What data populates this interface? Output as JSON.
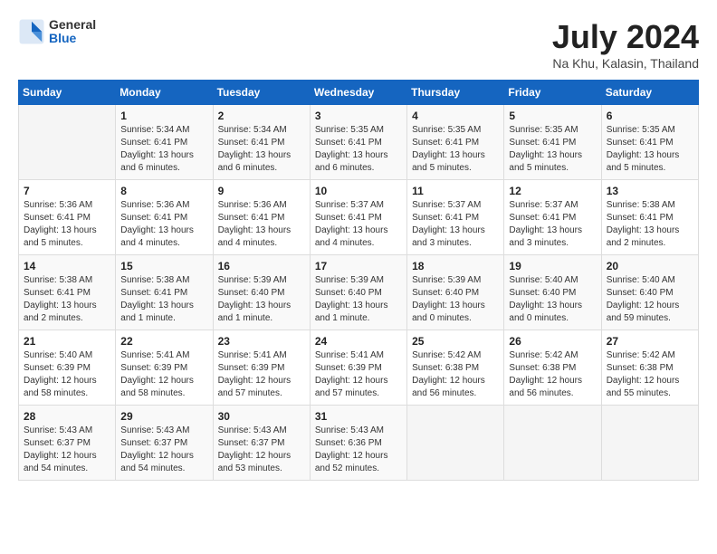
{
  "header": {
    "logo_general": "General",
    "logo_blue": "Blue",
    "month": "July 2024",
    "location": "Na Khu, Kalasin, Thailand"
  },
  "weekdays": [
    "Sunday",
    "Monday",
    "Tuesday",
    "Wednesday",
    "Thursday",
    "Friday",
    "Saturday"
  ],
  "weeks": [
    [
      null,
      {
        "day": 1,
        "sunrise": "5:34 AM",
        "sunset": "6:41 PM",
        "daylight": "13 hours and 6 minutes."
      },
      {
        "day": 2,
        "sunrise": "5:34 AM",
        "sunset": "6:41 PM",
        "daylight": "13 hours and 6 minutes."
      },
      {
        "day": 3,
        "sunrise": "5:35 AM",
        "sunset": "6:41 PM",
        "daylight": "13 hours and 6 minutes."
      },
      {
        "day": 4,
        "sunrise": "5:35 AM",
        "sunset": "6:41 PM",
        "daylight": "13 hours and 5 minutes."
      },
      {
        "day": 5,
        "sunrise": "5:35 AM",
        "sunset": "6:41 PM",
        "daylight": "13 hours and 5 minutes."
      },
      {
        "day": 6,
        "sunrise": "5:35 AM",
        "sunset": "6:41 PM",
        "daylight": "13 hours and 5 minutes."
      }
    ],
    [
      {
        "day": 7,
        "sunrise": "5:36 AM",
        "sunset": "6:41 PM",
        "daylight": "13 hours and 5 minutes."
      },
      {
        "day": 8,
        "sunrise": "5:36 AM",
        "sunset": "6:41 PM",
        "daylight": "13 hours and 4 minutes."
      },
      {
        "day": 9,
        "sunrise": "5:36 AM",
        "sunset": "6:41 PM",
        "daylight": "13 hours and 4 minutes."
      },
      {
        "day": 10,
        "sunrise": "5:37 AM",
        "sunset": "6:41 PM",
        "daylight": "13 hours and 4 minutes."
      },
      {
        "day": 11,
        "sunrise": "5:37 AM",
        "sunset": "6:41 PM",
        "daylight": "13 hours and 3 minutes."
      },
      {
        "day": 12,
        "sunrise": "5:37 AM",
        "sunset": "6:41 PM",
        "daylight": "13 hours and 3 minutes."
      },
      {
        "day": 13,
        "sunrise": "5:38 AM",
        "sunset": "6:41 PM",
        "daylight": "13 hours and 2 minutes."
      }
    ],
    [
      {
        "day": 14,
        "sunrise": "5:38 AM",
        "sunset": "6:41 PM",
        "daylight": "13 hours and 2 minutes."
      },
      {
        "day": 15,
        "sunrise": "5:38 AM",
        "sunset": "6:41 PM",
        "daylight": "13 hours and 1 minute."
      },
      {
        "day": 16,
        "sunrise": "5:39 AM",
        "sunset": "6:40 PM",
        "daylight": "13 hours and 1 minute."
      },
      {
        "day": 17,
        "sunrise": "5:39 AM",
        "sunset": "6:40 PM",
        "daylight": "13 hours and 1 minute."
      },
      {
        "day": 18,
        "sunrise": "5:39 AM",
        "sunset": "6:40 PM",
        "daylight": "13 hours and 0 minutes."
      },
      {
        "day": 19,
        "sunrise": "5:40 AM",
        "sunset": "6:40 PM",
        "daylight": "13 hours and 0 minutes."
      },
      {
        "day": 20,
        "sunrise": "5:40 AM",
        "sunset": "6:40 PM",
        "daylight": "12 hours and 59 minutes."
      }
    ],
    [
      {
        "day": 21,
        "sunrise": "5:40 AM",
        "sunset": "6:39 PM",
        "daylight": "12 hours and 58 minutes."
      },
      {
        "day": 22,
        "sunrise": "5:41 AM",
        "sunset": "6:39 PM",
        "daylight": "12 hours and 58 minutes."
      },
      {
        "day": 23,
        "sunrise": "5:41 AM",
        "sunset": "6:39 PM",
        "daylight": "12 hours and 57 minutes."
      },
      {
        "day": 24,
        "sunrise": "5:41 AM",
        "sunset": "6:39 PM",
        "daylight": "12 hours and 57 minutes."
      },
      {
        "day": 25,
        "sunrise": "5:42 AM",
        "sunset": "6:38 PM",
        "daylight": "12 hours and 56 minutes."
      },
      {
        "day": 26,
        "sunrise": "5:42 AM",
        "sunset": "6:38 PM",
        "daylight": "12 hours and 56 minutes."
      },
      {
        "day": 27,
        "sunrise": "5:42 AM",
        "sunset": "6:38 PM",
        "daylight": "12 hours and 55 minutes."
      }
    ],
    [
      {
        "day": 28,
        "sunrise": "5:43 AM",
        "sunset": "6:37 PM",
        "daylight": "12 hours and 54 minutes."
      },
      {
        "day": 29,
        "sunrise": "5:43 AM",
        "sunset": "6:37 PM",
        "daylight": "12 hours and 54 minutes."
      },
      {
        "day": 30,
        "sunrise": "5:43 AM",
        "sunset": "6:37 PM",
        "daylight": "12 hours and 53 minutes."
      },
      {
        "day": 31,
        "sunrise": "5:43 AM",
        "sunset": "6:36 PM",
        "daylight": "12 hours and 52 minutes."
      },
      null,
      null,
      null
    ]
  ]
}
